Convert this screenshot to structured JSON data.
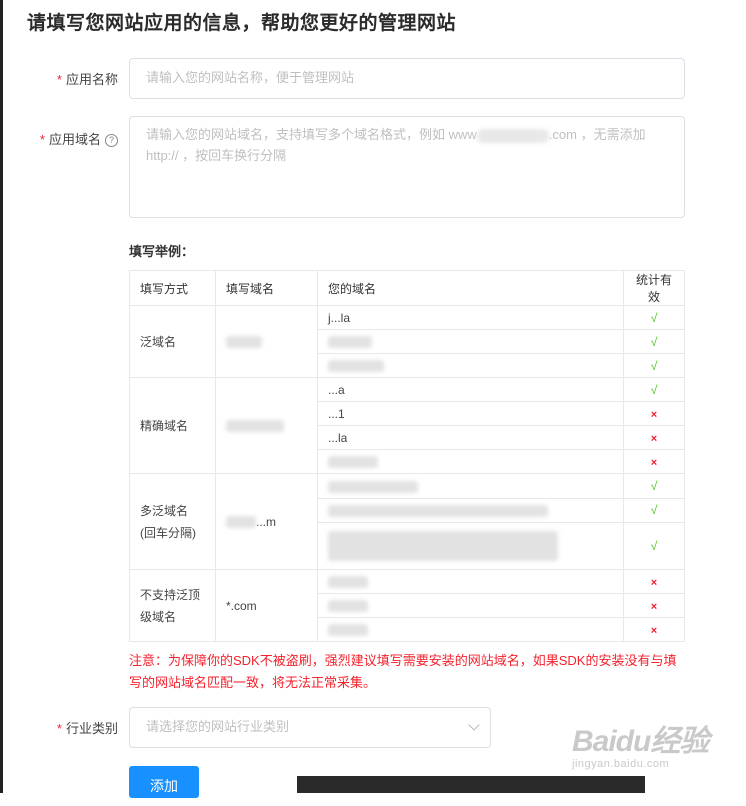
{
  "page": {
    "title": "请填写您网站应用的信息，帮助您更好的管理网站"
  },
  "form": {
    "required_mark": "*",
    "app_name": {
      "label": "应用名称",
      "placeholder": "请输入您的网站名称，便于管理网站"
    },
    "app_domain": {
      "label": "应用域名",
      "help_icon": "?",
      "placeholder_a": "请输入您的网站域名，支持填写多个域名格式，例如 www",
      "placeholder_b": ".com ，无需添加",
      "placeholder_c": "http:// ，按回车换行分隔"
    },
    "industry": {
      "label": "行业类别",
      "placeholder": "请选择您的网站行业类别"
    },
    "submit_label": "添加"
  },
  "examples": {
    "title": "填写举例：",
    "headers": [
      "填写方式",
      "填写域名",
      "您的域名",
      "统计有效"
    ],
    "groups": [
      {
        "method": "泛域名",
        "domain": "",
        "rows": [
          {
            "yours": "j...la",
            "valid": "√"
          },
          {
            "yours": "",
            "valid": "√"
          },
          {
            "yours": "",
            "valid": "√"
          }
        ]
      },
      {
        "method": "精确域名",
        "domain": "",
        "rows": [
          {
            "yours": "...a",
            "valid": "√"
          },
          {
            "yours": "...1",
            "valid": "×"
          },
          {
            "yours": "...la",
            "valid": "×"
          },
          {
            "yours": "",
            "valid": "×"
          }
        ]
      },
      {
        "method": "多泛域名",
        "method_sub": "(回车分隔)",
        "domain": "...m",
        "rows": [
          {
            "yours": "",
            "valid": "√"
          },
          {
            "yours": "",
            "valid": "√"
          },
          {
            "yours": "",
            "valid": "√"
          }
        ]
      },
      {
        "method": "不支持泛顶",
        "method_sub": "级域名",
        "domain": "*.com",
        "rows": [
          {
            "yours": "",
            "valid": "×"
          },
          {
            "yours": "",
            "valid": "×"
          },
          {
            "yours": "",
            "valid": "×"
          }
        ]
      }
    ]
  },
  "warning": "注意：为保障你的SDK不被盗刷，强烈建议填写需要安装的网站域名，如果SDK的安装没有与填写的网站域名匹配一致，将无法正常采集。",
  "watermark": {
    "logo": "Baidu经验",
    "sub": "jingyan.baidu.com"
  }
}
